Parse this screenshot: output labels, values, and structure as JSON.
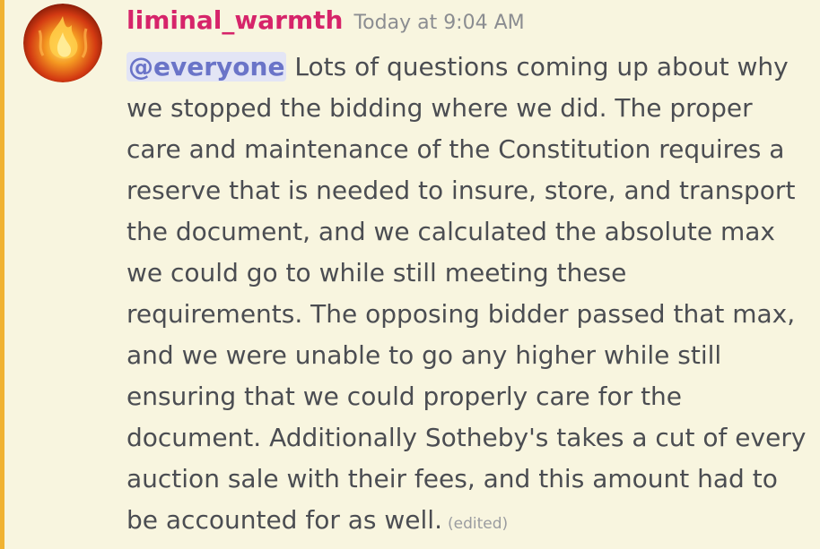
{
  "message": {
    "username": "liminal_warmth",
    "timestamp": "Today at 9:04 AM",
    "mention": "@everyone",
    "text": "Lots of questions coming up about why we stopped the bidding where we did. The proper care and maintenance of the Constitution requires a reserve that is needed to insure, store, and transport the document, and we calculated the absolute max we could go to while still meeting these requirements. The opposing bidder passed that max, and we were unable to go any higher while still ensuring that we could properly care for the document. Additionally Sotheby's takes a cut of every auction sale with their fees, and this amount had to be accounted for as well.",
    "edited_label": "(edited)"
  },
  "colors": {
    "username": "#d6246a",
    "mention_bg": "#e3e5f5",
    "mention_fg": "#6a74c8",
    "highlight_bar": "#f0b232",
    "background": "#f8f5df",
    "text": "#4b4d52"
  },
  "icons": {
    "avatar": "flame-avatar-icon"
  }
}
